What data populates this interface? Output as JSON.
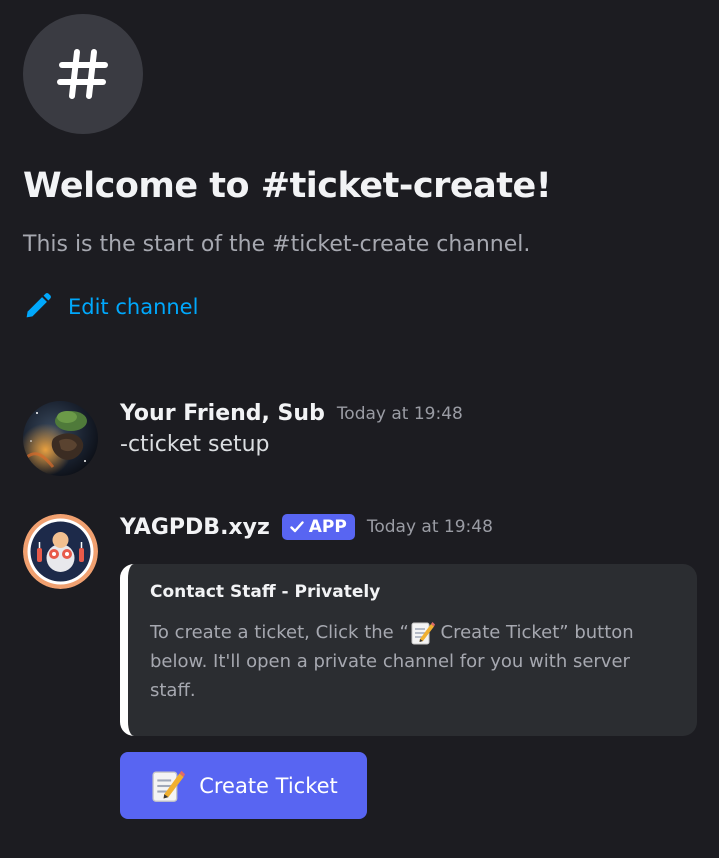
{
  "channel": {
    "icon": "hash-icon",
    "welcome_title": "Welcome to #ticket-create!",
    "welcome_subtitle": "This is the start of the #ticket-create channel.",
    "edit_label": "Edit channel"
  },
  "messages": [
    {
      "author": "Your Friend, Sub",
      "timestamp": "Today at 19:48",
      "text": "-cticket setup",
      "avatar_icon": "planet-avatar-icon"
    },
    {
      "author": "YAGPDB.xyz",
      "badge": "APP",
      "timestamp": "Today at 19:48",
      "avatar_icon": "bot-avatar-icon",
      "embed": {
        "title": "Contact Staff - Privately",
        "desc_before": "To create a ticket, Click the “",
        "desc_after": " Create Ticket” button below. It'll open a private channel for you with server staff.",
        "border_color": "#ffffff"
      },
      "button": {
        "label": "Create Ticket",
        "icon": "memo-icon"
      }
    }
  ],
  "colors": {
    "background": "#1c1c21",
    "blurple": "#5865f2",
    "link": "#00a8fc",
    "embed_bg": "#2b2d31"
  }
}
